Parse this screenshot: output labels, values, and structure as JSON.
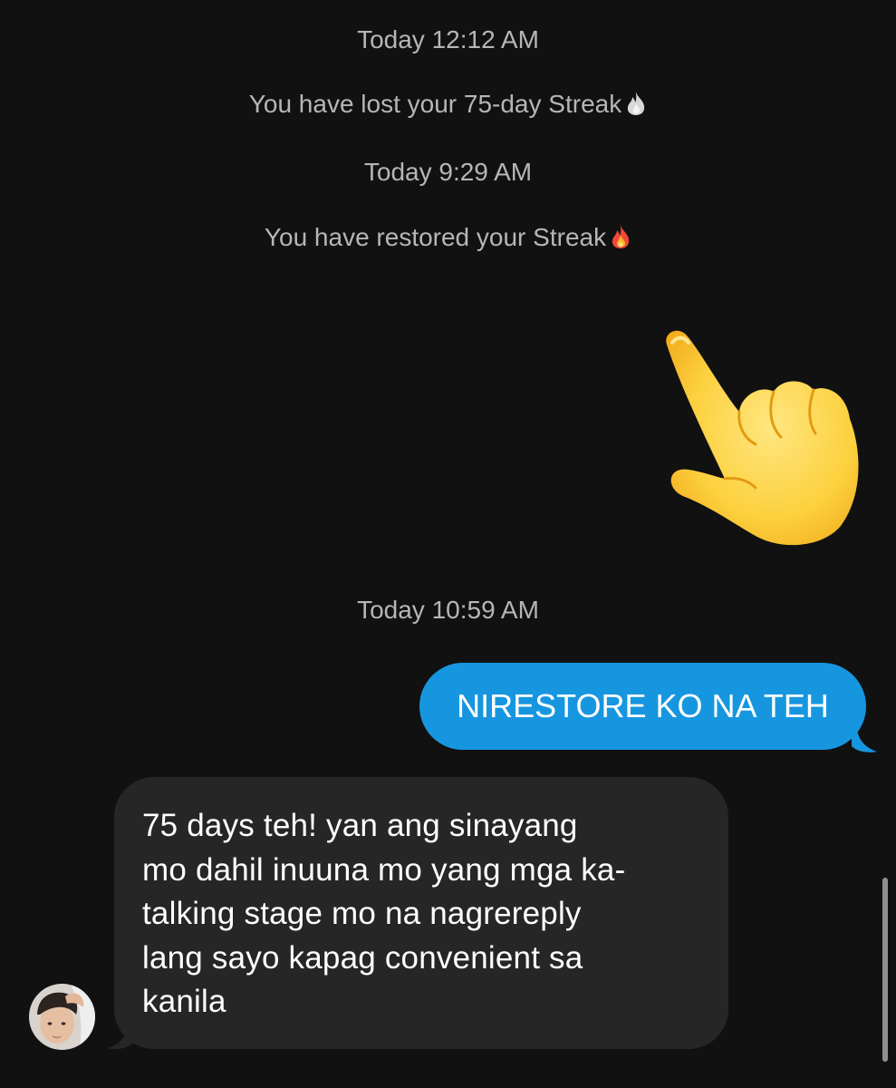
{
  "thread": {
    "timestamp_1": "Today 12:12 AM",
    "event_1": "You have lost your 75-day Streak",
    "event_1_icon": "grey-flame-icon",
    "timestamp_2": "Today 9:29 AM",
    "event_2": "You have restored your Streak",
    "event_2_icon": "fire-icon",
    "sticker": "backhand-index-pointing-down-emoji",
    "timestamp_3": "Today 10:59 AM",
    "outgoing_message": "NIRESTORE KO NA TEH",
    "incoming_message_lines": [
      "75 days teh! yan ang sinayang",
      "mo dahil inuuna mo yang mga ka-",
      "talking stage mo na nagrereply",
      "lang sayo kapag convenient sa",
      "kanila"
    ]
  },
  "colors": {
    "background": "#111111",
    "system_text": "#b6b6b6",
    "outgoing_bubble": "#1796e0",
    "incoming_bubble": "#262626"
  }
}
